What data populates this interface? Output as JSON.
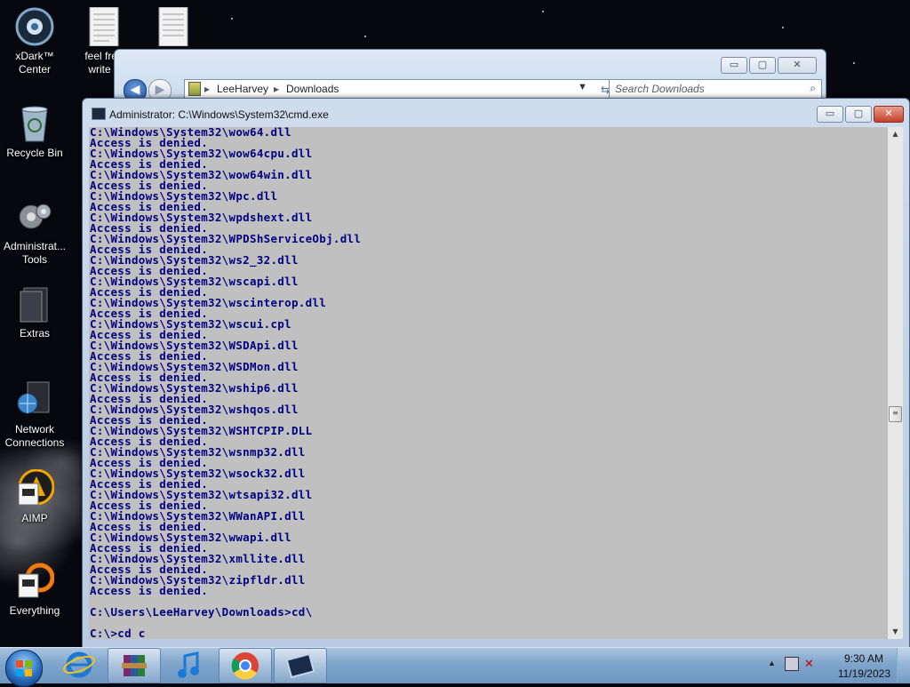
{
  "desktop": {
    "icons": [
      {
        "label": "xDark™ Center",
        "icon": "xdark-orb-icon"
      },
      {
        "label": "feel free write a",
        "icon": "text-document-icon"
      },
      {
        "label": "",
        "icon": "text-document-icon"
      },
      {
        "label": "Recycle Bin",
        "icon": "recycle-bin-icon"
      },
      {
        "label": "Administrat... Tools",
        "icon": "admin-tools-icon"
      },
      {
        "label": "Extras",
        "icon": "folder-icon"
      },
      {
        "label": "Network Connections",
        "icon": "network-icon"
      },
      {
        "label": "AIMP",
        "icon": "aimp-icon"
      },
      {
        "label": "Everything",
        "icon": "everything-search-icon"
      }
    ]
  },
  "explorer": {
    "path": [
      "LeeHarvey",
      "Downloads"
    ],
    "search_placeholder": "Search Downloads",
    "minimize": "▭",
    "maximize": "▢",
    "close": "✕"
  },
  "cmd": {
    "title": "Administrator: C:\\Windows\\System32\\cmd.exe",
    "lines": [
      "C:\\Windows\\System32\\wow64.dll",
      "Access is denied.",
      "C:\\Windows\\System32\\wow64cpu.dll",
      "Access is denied.",
      "C:\\Windows\\System32\\wow64win.dll",
      "Access is denied.",
      "C:\\Windows\\System32\\Wpc.dll",
      "Access is denied.",
      "C:\\Windows\\System32\\wpdshext.dll",
      "Access is denied.",
      "C:\\Windows\\System32\\WPDShServiceObj.dll",
      "Access is denied.",
      "C:\\Windows\\System32\\ws2_32.dll",
      "Access is denied.",
      "C:\\Windows\\System32\\wscapi.dll",
      "Access is denied.",
      "C:\\Windows\\System32\\wscinterop.dll",
      "Access is denied.",
      "C:\\Windows\\System32\\wscui.cpl",
      "Access is denied.",
      "C:\\Windows\\System32\\WSDApi.dll",
      "Access is denied.",
      "C:\\Windows\\System32\\WSDMon.dll",
      "Access is denied.",
      "C:\\Windows\\System32\\wship6.dll",
      "Access is denied.",
      "C:\\Windows\\System32\\wshqos.dll",
      "Access is denied.",
      "C:\\Windows\\System32\\WSHTCPIP.DLL",
      "Access is denied.",
      "C:\\Windows\\System32\\wsnmp32.dll",
      "Access is denied.",
      "C:\\Windows\\System32\\wsock32.dll",
      "Access is denied.",
      "C:\\Windows\\System32\\wtsapi32.dll",
      "Access is denied.",
      "C:\\Windows\\System32\\WWanAPI.dll",
      "Access is denied.",
      "C:\\Windows\\System32\\wwapi.dll",
      "Access is denied.",
      "C:\\Windows\\System32\\xmllite.dll",
      "Access is denied.",
      "C:\\Windows\\System32\\zipfldr.dll",
      "Access is denied.",
      "",
      "C:\\Users\\LeeHarvey\\Downloads>cd\\",
      "",
      "C:\\>cd c"
    ],
    "minimize": "▭",
    "maximize": "▢",
    "close": "✕"
  },
  "taskbar": {
    "pinned": [
      {
        "name": "internet-explorer",
        "icon": "ie-icon"
      },
      {
        "name": "winrar",
        "icon": "winrar-icon"
      },
      {
        "name": "itunes",
        "icon": "music-note-icon"
      },
      {
        "name": "chrome",
        "icon": "chrome-icon"
      },
      {
        "name": "cmd",
        "icon": "cmd-icon"
      }
    ],
    "time": "9:30 AM",
    "date": "11/19/2023"
  }
}
